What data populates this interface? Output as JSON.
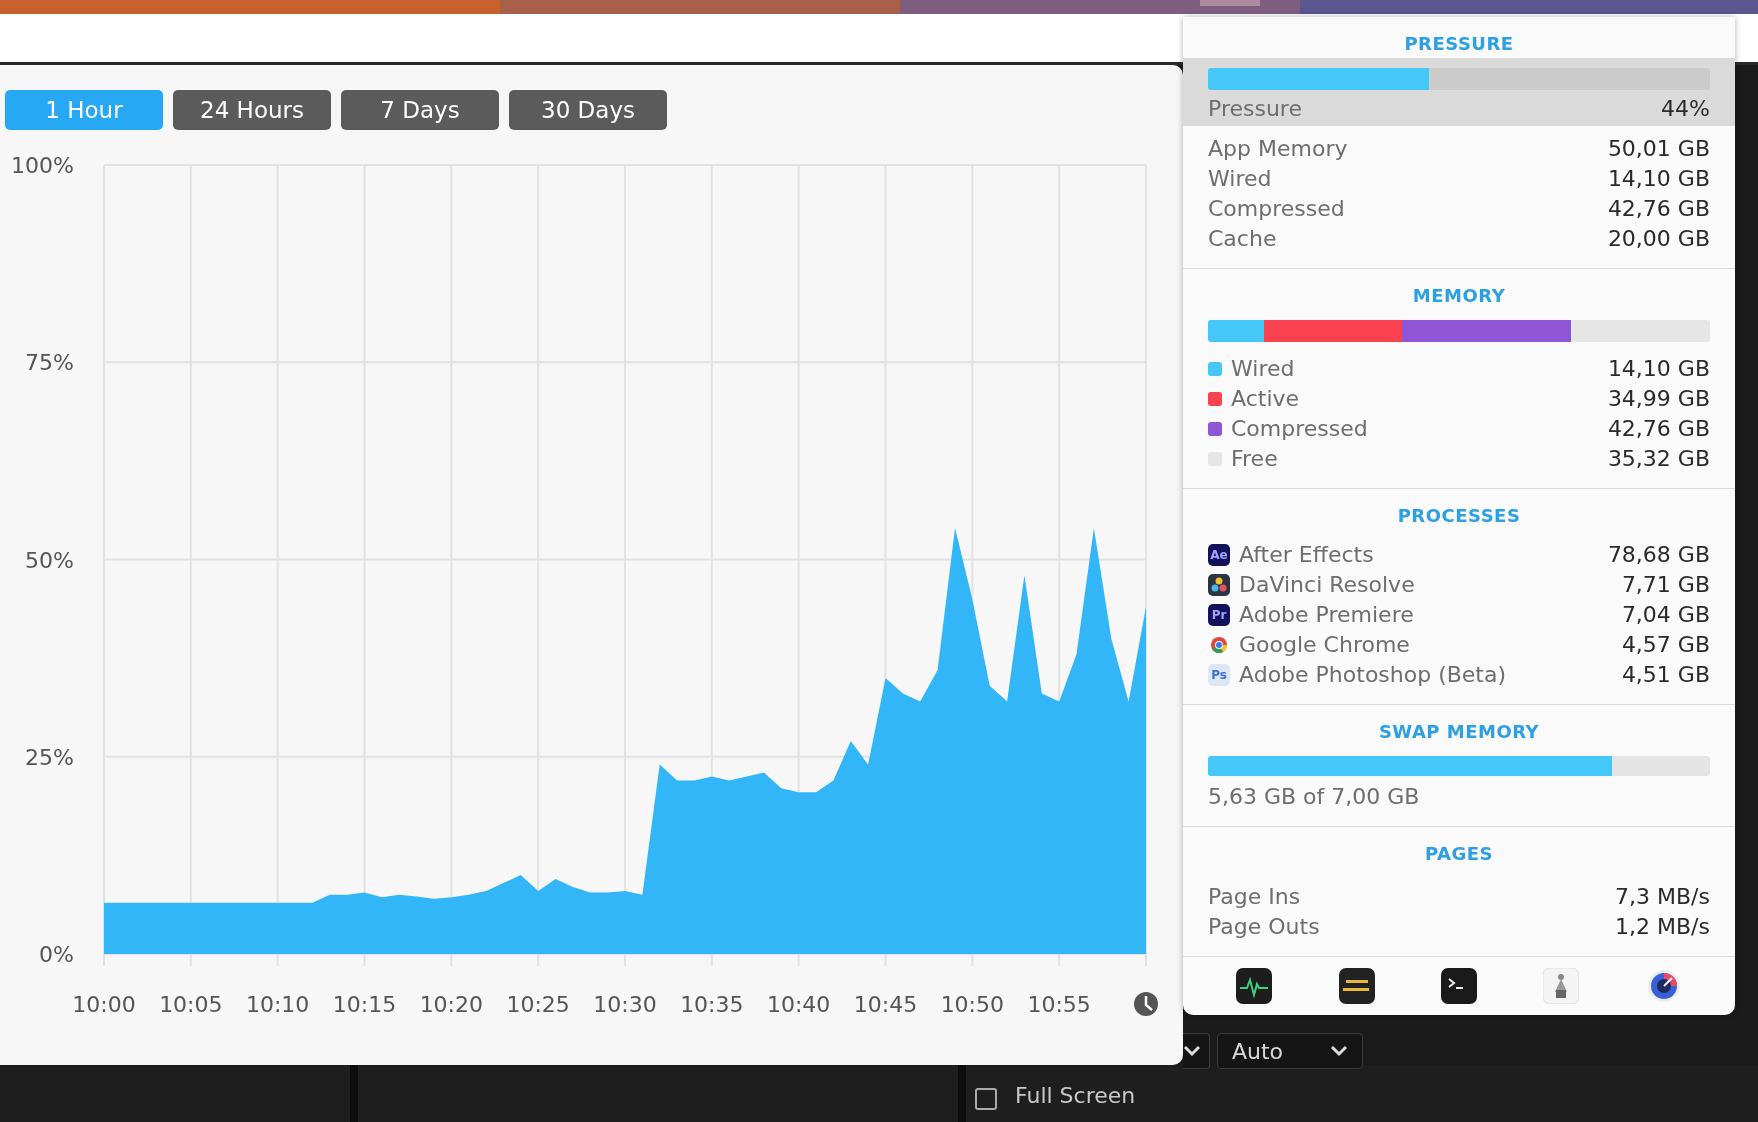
{
  "range_tabs": [
    {
      "label": "1 Hour",
      "selected": true
    },
    {
      "label": "24 Hours",
      "selected": false
    },
    {
      "label": "7 Days",
      "selected": false
    },
    {
      "label": "30 Days",
      "selected": false
    }
  ],
  "chart_data": {
    "type": "area",
    "categories": [
      "10:00",
      null,
      null,
      null,
      null,
      "10:05",
      null,
      null,
      null,
      null,
      "10:10",
      null,
      null,
      null,
      null,
      "10:15",
      null,
      null,
      null,
      null,
      "10:20",
      null,
      null,
      null,
      null,
      "10:25",
      null,
      null,
      null,
      null,
      "10:30",
      null,
      null,
      null,
      null,
      "10:35",
      null,
      null,
      null,
      null,
      "10:40",
      null,
      null,
      null,
      null,
      "10:45",
      null,
      null,
      null,
      null,
      "10:50",
      null,
      null,
      null,
      null,
      "10:55",
      null,
      null,
      null,
      null,
      null
    ],
    "values": [
      6.5,
      6.5,
      6.5,
      6.5,
      6.5,
      6.5,
      6.5,
      6.5,
      6.5,
      6.5,
      6.5,
      6.5,
      6.5,
      7.5,
      7.5,
      7.8,
      7.2,
      7.5,
      7.3,
      7.0,
      7.2,
      7.5,
      8,
      9,
      10,
      8,
      9.5,
      8.5,
      7.8,
      7.8,
      8,
      7.5,
      24,
      22,
      22,
      22.5,
      22,
      22.5,
      23,
      21,
      20.5,
      20.5,
      22,
      27,
      24,
      35,
      33,
      32,
      36,
      54,
      45,
      34,
      32,
      48,
      33,
      32,
      38,
      54,
      40,
      32,
      44
    ],
    "ylim": [
      0,
      100
    ],
    "grid": true,
    "yticks": [
      {
        "value": 0,
        "label": "0%"
      },
      {
        "value": 25,
        "label": "25%"
      },
      {
        "value": 50,
        "label": "50%"
      },
      {
        "value": 75,
        "label": "75%"
      },
      {
        "value": 100,
        "label": "100%"
      }
    ]
  },
  "popup": {
    "pressure": {
      "title": "PRESSURE",
      "level": 0.44,
      "label": "Pressure",
      "reading": "44%",
      "rows": [
        {
          "label": "App Memory",
          "value": "50,01 GB"
        },
        {
          "label": "Wired",
          "value": "14,10 GB"
        },
        {
          "label": "Compressed",
          "value": "42,76 GB"
        },
        {
          "label": "Cache",
          "value": "20,00 GB"
        }
      ]
    },
    "memory": {
      "title": "MEMORY",
      "items": [
        {
          "label": "Wired",
          "value": "14,10 GB",
          "color": "#45c8f8"
        },
        {
          "label": "Active",
          "value": "34,99 GB",
          "color": "#fa4150"
        },
        {
          "label": "Compressed",
          "value": "42,76 GB",
          "color": "#8e56d6"
        },
        {
          "label": "Free",
          "value": "35,32 GB",
          "color": "#e6e6e6"
        }
      ]
    },
    "processes": {
      "title": "PROCESSES",
      "items": [
        {
          "name": "After Effects",
          "value": "78,68 GB",
          "kind": "badge",
          "icon_label": "Ae"
        },
        {
          "name": "DaVinci Resolve",
          "value": "7,71 GB",
          "kind": "dots"
        },
        {
          "name": "Adobe Premiere",
          "value": "7,04 GB",
          "kind": "badge",
          "icon_label": "Pr"
        },
        {
          "name": "Google Chrome",
          "value": "4,57 GB",
          "kind": "ring"
        },
        {
          "name": "Adobe Photoshop (Beta)",
          "value": "4,51 GB",
          "kind": "lightbadge",
          "icon_label": "Ps"
        }
      ]
    },
    "swap": {
      "title": "SWAP MEMORY",
      "level": 0.805,
      "reading": "5,63 GB of 7,00 GB"
    },
    "pages": {
      "title": "PAGES",
      "rows": [
        {
          "label": "Page Ins",
          "value": "7,3 MB/s"
        },
        {
          "label": "Page Outs",
          "value": "1,2 MB/s"
        }
      ]
    }
  },
  "background_panel": {
    "resolution_value": "Auto",
    "full_screen": {
      "label": "Full Screen",
      "checked": false
    }
  }
}
